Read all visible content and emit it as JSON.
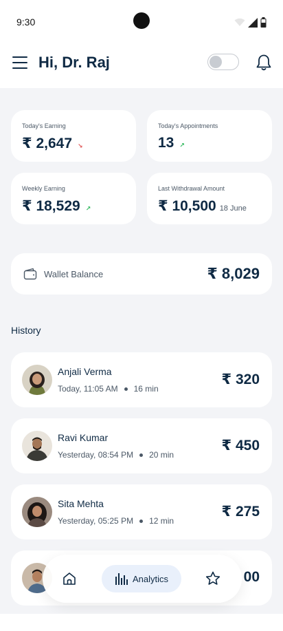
{
  "status_bar": {
    "time": "9:30"
  },
  "header": {
    "greeting": "Hi, Dr. Raj"
  },
  "stats": [
    {
      "label": "Today's  Earning",
      "value": "₹ 2,647",
      "trend": "down",
      "trend_glyph": "↘"
    },
    {
      "label": "Today's Appointments",
      "value": "13",
      "trend": "up",
      "trend_glyph": "↗"
    },
    {
      "label": "Weekly Earning",
      "value": "₹ 18,529",
      "trend": "up",
      "trend_glyph": "↗"
    },
    {
      "label": "Last Withdrawal Amount",
      "value": "₹ 10,500",
      "date": "18 June"
    }
  ],
  "wallet": {
    "label": "Wallet Balance",
    "value": "₹ 8,029"
  },
  "history": {
    "title": "History",
    "items": [
      {
        "name": "Anjali Verma",
        "time": "Today, 11:05 AM",
        "duration": "16 min",
        "amount": "₹ 320"
      },
      {
        "name": "Ravi Kumar",
        "time": "Yesterday, 08:54 PM",
        "duration": "20 min",
        "amount": "₹ 450"
      },
      {
        "name": "Sita Mehta",
        "time": "Yesterday, 05:25 PM",
        "duration": "12 min",
        "amount": "₹ 275"
      },
      {
        "name": "",
        "time": "",
        "duration": "",
        "amount": "00"
      }
    ]
  },
  "nav": {
    "home_icon": "home-icon",
    "active_label": "Analytics",
    "star_icon": "star-icon"
  },
  "colors": {
    "primary_text": "#0f2a44",
    "background": "#f3f4f7",
    "card": "#ffffff",
    "active_tab": "#e9f0fb",
    "trend_up": "#2eb85c",
    "trend_down": "#e05252"
  }
}
